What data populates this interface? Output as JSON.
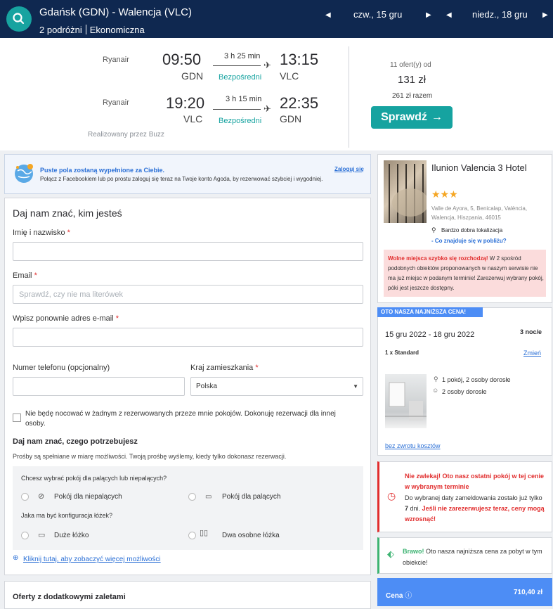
{
  "header": {
    "route": "Gdańsk (GDN) - Walencja (VLC)",
    "travelers": "2 podróżni",
    "cabin": "Ekonomiczna",
    "depart_date": "czw., 15 gru",
    "return_date": "niedz., 18 gru"
  },
  "flights": [
    {
      "airline": "Ryanair",
      "dep_time": "09:50",
      "dep_airport": "GDN",
      "duration": "3 h 25 min",
      "type": "Bezpośredni",
      "arr_time": "13:15",
      "arr_airport": "VLC"
    },
    {
      "airline": "Ryanair",
      "dep_time": "19:20",
      "dep_airport": "VLC",
      "duration": "3 h 15 min",
      "type": "Bezpośredni",
      "arr_time": "22:35",
      "arr_airport": "GDN"
    }
  ],
  "operated_by": "Realizowany przez Buzz",
  "offer": {
    "count": "11 ofert(y) od",
    "price": "131 zł",
    "total": "261 zł razem",
    "button": "Sprawdź"
  },
  "fb_banner": {
    "title": "Puste pola zostaną wypełnione za Ciebie.",
    "text": "Połącz z Facebookiem lub po prostu zaloguj się teraz na Twoje konto Agoda, by rezerwować szybciej i wygodniej.",
    "login": "Zaloguj się"
  },
  "form": {
    "heading": "Daj nam znać, kim jesteś",
    "name_label": "Imię i nazwisko",
    "email_label": "Email",
    "email_placeholder": "Sprawdź, czy nie ma literówek",
    "email2_label": "Wpisz ponownie adres e-mail",
    "phone_label": "Numer telefonu (opcjonalny)",
    "country_label": "Kraj zamieszkania",
    "country_value": "Polska",
    "checkbox_text": "Nie będę nocować w żadnym z rezerwowanych przeze mnie pokojów. Dokonuję rezerwacji dla innej osoby.",
    "req_mark": "*"
  },
  "needs": {
    "heading": "Daj nam znać, czego potrzebujesz",
    "sub": "Prośby są spełniane w miarę możliwości. Twoją prośbę wyślemy, kiedy tylko dokonasz rezerwacji.",
    "smoking_q": "Chcesz wybrać pokój dla palących lub niepalących?",
    "non_smoking": "Pokój dla niepalących",
    "smoking": "Pokój dla palących",
    "bed_q": "Jaka ma być konfiguracja łóżek?",
    "large_bed": "Duże łóżko",
    "twin_beds": "Dwa osobne łóżka",
    "more": "Kliknij tutaj, aby zobaczyć więcej możliwości"
  },
  "extras": {
    "heading": "Oferty z dodatkowymi zaletami"
  },
  "hotel": {
    "name": "Ilunion Valencia 3 Hotel",
    "stars": "★★★",
    "address": "Valle de Ayora, 5, Benicalap, València, Walencja, Hiszpania, 46015",
    "location": "Bardzo dobra lokalizacja",
    "nearby": "- Co znajduje się w pobliżu?",
    "alert_bold": "Wolne miejsca szybko się rozchodzą!",
    "alert_text": "W 2 spośród podobnych obiektów proponowanych w naszym serwisie nie ma już miejsc w podanym terminie! Zarezerwuj wybrany pokój, póki jest jeszcze dostępny."
  },
  "room": {
    "badge": "OTO NASZA NAJNIŻSZA CENA!",
    "dates": "15 gru 2022 - 18 gru 2022",
    "nights": "3 noc/e",
    "room_type": "1 x Standard",
    "change": "Zmień",
    "occupancy": "1 pokój, 2 osoby dorosłe",
    "adults": "2 osoby dorosłe",
    "refund": "bez zwrotu kosztów"
  },
  "urgency": {
    "title": "Nie zwlekaj! Oto nasz ostatni pokój w tej cenie w wybranym terminie",
    "text1": "Do wybranej daty zameldowania zostało już tylko",
    "days": "7",
    "text2": "dni.",
    "bold": "Jeśli nie zarezerwujesz teraz, ceny mogą wzrosnąć!"
  },
  "bravo": {
    "bold": "Brawo!",
    "text": "Oto nasza najniższa cena za pobyt w tym obiekcie!"
  },
  "price": {
    "label": "Cena",
    "value": "710,40 zł"
  },
  "colors": {
    "header": "#0f2850",
    "accent": "#16a3a0",
    "alert": "#e12d2d",
    "price_bar": "#4d8df5"
  }
}
